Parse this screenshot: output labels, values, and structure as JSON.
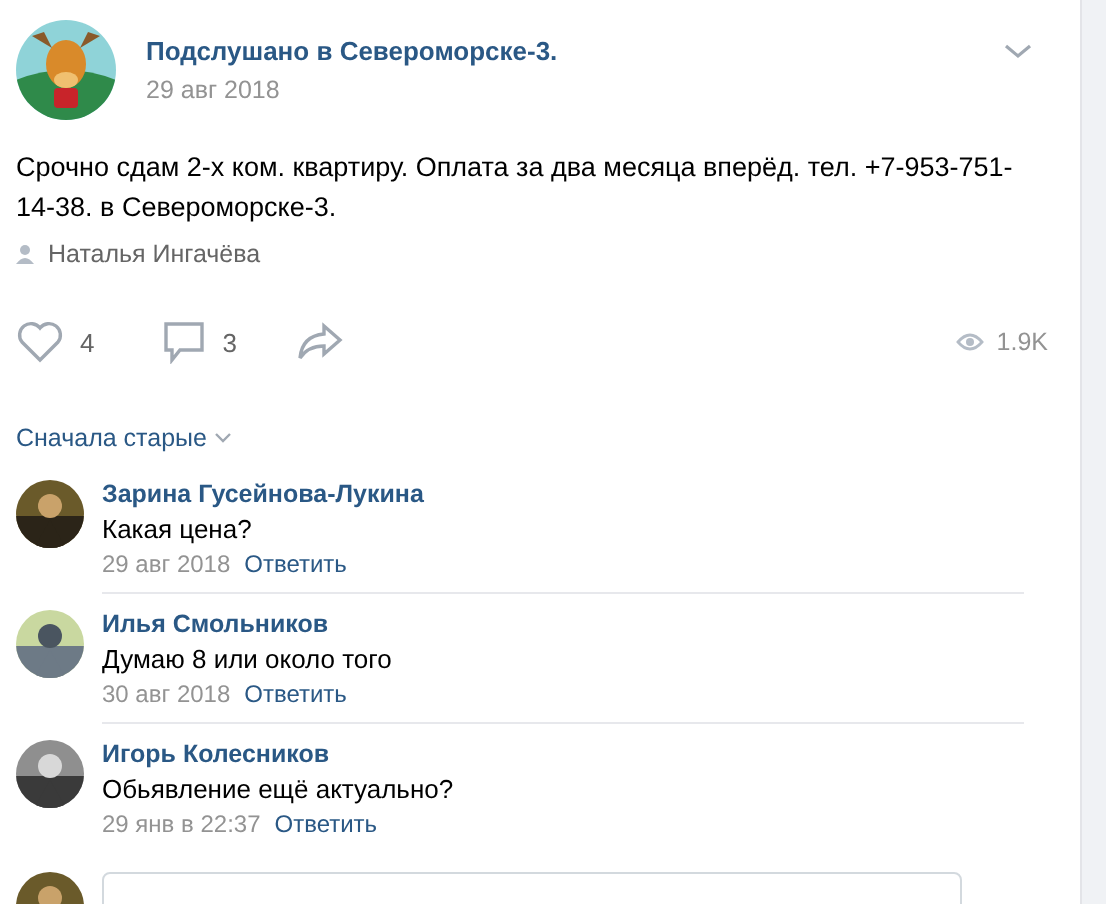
{
  "post": {
    "author": "Подслушано в Североморске-3.",
    "date": "29 авг 2018",
    "text": "Срочно сдам 2-х ком. квартиру. Оплата за два месяца вперёд. тел. +7-953-751-14-38. в Североморске-3.",
    "signer": "Наталья Ингачёва"
  },
  "actions": {
    "likes": "4",
    "comments": "3",
    "views": "1.9K"
  },
  "sort": {
    "label": "Сначала старые"
  },
  "comments": [
    {
      "name": "Зарина Гусейнова-Лукина",
      "text": "Какая цена?",
      "date": "29 авг 2018",
      "reply": "Ответить"
    },
    {
      "name": "Илья Смольников",
      "text": "Думаю 8 или около того",
      "date": "30 авг 2018",
      "reply": "Ответить"
    },
    {
      "name": "Игорь Колесников",
      "text": "Обьявление ещё актуально?",
      "date": "29 янв в 22:37",
      "reply": "Ответить"
    }
  ]
}
